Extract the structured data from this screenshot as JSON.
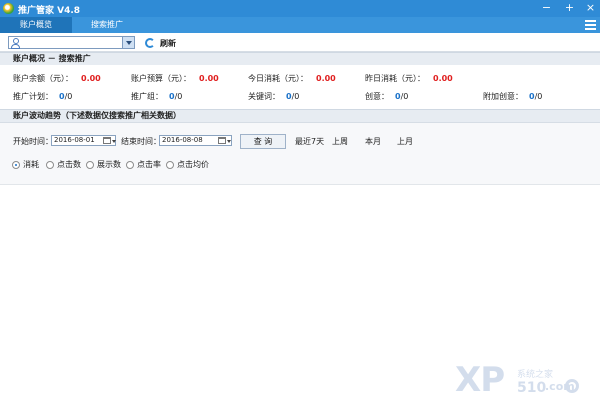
{
  "app": {
    "title": "推广管家 V4.8"
  },
  "window": {
    "minimize": "−",
    "maximize": "+",
    "close": "×"
  },
  "tabs": [
    {
      "label": "账户概览",
      "active": true
    },
    {
      "label": "搜索推广",
      "active": false
    }
  ],
  "toolbar": {
    "account_value": "",
    "refresh_label": "刷新"
  },
  "overview": {
    "title": "账户概况 － 搜索推广",
    "metrics": [
      {
        "label": "账户余额（元）：",
        "value": "0.00"
      },
      {
        "label": "账户预算（元）：",
        "value": "0.00"
      },
      {
        "label": "今日消耗（元）：",
        "value": "0.00"
      },
      {
        "label": "昨日消耗（元）：",
        "value": "0.00"
      }
    ],
    "counts": [
      {
        "label": "推广计划：",
        "value": "0",
        "suffix": "/0"
      },
      {
        "label": "推广组：",
        "value": "0",
        "suffix": "/0"
      },
      {
        "label": "关键词：",
        "value": "0",
        "suffix": "/0"
      },
      {
        "label": "创意：",
        "value": "0",
        "suffix": "/0"
      },
      {
        "label": "附加创意：",
        "value": "0",
        "suffix": "/0"
      }
    ]
  },
  "trend": {
    "title": "账户波动趋势（下述数据仅搜索推广相关数据）",
    "start_label": "开始时间：",
    "start_value": "2016-08-01",
    "end_label": "结束时间：",
    "end_value": "2016-08-08",
    "query_label": "查 询",
    "periods": [
      "最近7天",
      "上周",
      "本月",
      "上月"
    ],
    "metrics": [
      {
        "label": "消耗",
        "checked": true
      },
      {
        "label": "点击数",
        "checked": false
      },
      {
        "label": "展示数",
        "checked": false
      },
      {
        "label": "点击率",
        "checked": false
      },
      {
        "label": "点击均价",
        "checked": false
      }
    ]
  },
  "watermark": {
    "brand": "XP",
    "site": "系统之家",
    "number": "510",
    "suffix": ".com"
  },
  "colors": {
    "titlebar": "#2f8bd6",
    "accent_red": "#e02020",
    "accent_blue": "#1b72c9"
  }
}
